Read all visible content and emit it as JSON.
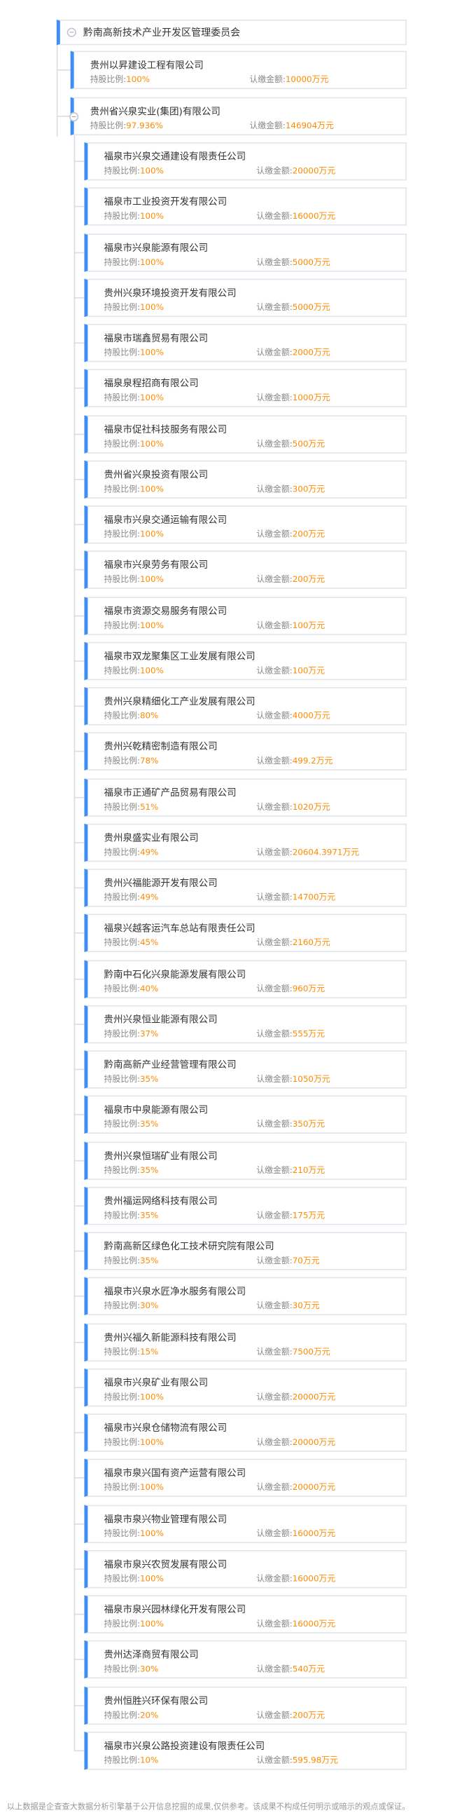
{
  "root": {
    "name": "黔南高新技术产业开发区管理委员会"
  },
  "labels": {
    "share": "持股比例:",
    "capital": "认缴金额:"
  },
  "level1": [
    {
      "name": "贵州以昇建设工程有限公司",
      "share": "100%",
      "capital": "10000万元"
    },
    {
      "name": "贵州省兴泉实业(集团)有限公司",
      "share": "97.936%",
      "capital": "146904万元"
    }
  ],
  "level2": [
    {
      "name": "福泉市兴泉交通建设有限责任公司",
      "share": "100%",
      "capital": "20000万元"
    },
    {
      "name": "福泉市工业投资开发有限公司",
      "share": "100%",
      "capital": "16000万元"
    },
    {
      "name": "福泉市兴泉能源有限公司",
      "share": "100%",
      "capital": "5000万元"
    },
    {
      "name": "贵州兴泉环境投资开发有限公司",
      "share": "100%",
      "capital": "5000万元"
    },
    {
      "name": "福泉市瑞鑫贸易有限公司",
      "share": "100%",
      "capital": "2000万元"
    },
    {
      "name": "福泉泉程招商有限公司",
      "share": "100%",
      "capital": "1000万元"
    },
    {
      "name": "福泉市促社科技服务有限公司",
      "share": "100%",
      "capital": "500万元"
    },
    {
      "name": "贵州省兴泉投资有限公司",
      "share": "100%",
      "capital": "300万元"
    },
    {
      "name": "福泉市兴泉交通运输有限公司",
      "share": "100%",
      "capital": "200万元"
    },
    {
      "name": "福泉市兴泉劳务有限公司",
      "share": "100%",
      "capital": "200万元"
    },
    {
      "name": "福泉市资源交易服务有限公司",
      "share": "100%",
      "capital": "100万元"
    },
    {
      "name": "福泉市双龙聚集区工业发展有限公司",
      "share": "100%",
      "capital": "100万元"
    },
    {
      "name": "贵州兴泉精细化工产业发展有限公司",
      "share": "80%",
      "capital": "4000万元"
    },
    {
      "name": "贵州兴乾精密制造有限公司",
      "share": "78%",
      "capital": "499.2万元"
    },
    {
      "name": "福泉市正通矿产品贸易有限公司",
      "share": "51%",
      "capital": "1020万元"
    },
    {
      "name": "贵州泉盛实业有限公司",
      "share": "49%",
      "capital": "20604.3971万元"
    },
    {
      "name": "贵州兴福能源开发有限公司",
      "share": "49%",
      "capital": "14700万元"
    },
    {
      "name": "福泉兴越客运汽车总站有限责任公司",
      "share": "45%",
      "capital": "2160万元"
    },
    {
      "name": "黔南中石化兴泉能源发展有限公司",
      "share": "40%",
      "capital": "960万元"
    },
    {
      "name": "贵州兴泉恒业能源有限公司",
      "share": "37%",
      "capital": "555万元"
    },
    {
      "name": "黔南高新产业经营管理有限公司",
      "share": "35%",
      "capital": "1050万元"
    },
    {
      "name": "福泉市中泉能源有限公司",
      "share": "35%",
      "capital": "350万元"
    },
    {
      "name": "贵州兴泉恒瑞矿业有限公司",
      "share": "35%",
      "capital": "210万元"
    },
    {
      "name": "贵州福运网络科技有限公司",
      "share": "35%",
      "capital": "175万元"
    },
    {
      "name": "黔南高新区绿色化工技术研究院有限公司",
      "share": "35%",
      "capital": "70万元"
    },
    {
      "name": "福泉市兴泉水匠净水服务有限公司",
      "share": "30%",
      "capital": "30万元"
    },
    {
      "name": "贵州兴福久新能源科技有限公司",
      "share": "15%",
      "capital": "7500万元"
    },
    {
      "name": "福泉市兴泉矿业有限公司",
      "share": "100%",
      "capital": "20000万元"
    },
    {
      "name": "福泉市兴泉仓储物流有限公司",
      "share": "100%",
      "capital": "20000万元"
    },
    {
      "name": "福泉市泉兴国有资产运营有限公司",
      "share": "100%",
      "capital": "20000万元"
    },
    {
      "name": "福泉市泉兴物业管理有限公司",
      "share": "100%",
      "capital": "16000万元"
    },
    {
      "name": "福泉市泉兴农贸发展有限公司",
      "share": "100%",
      "capital": "16000万元"
    },
    {
      "name": "福泉市泉兴园林绿化开发有限公司",
      "share": "100%",
      "capital": "16000万元"
    },
    {
      "name": "贵州达泽商贸有限公司",
      "share": "30%",
      "capital": "540万元"
    },
    {
      "name": "贵州恒胜兴环保有限公司",
      "share": "20%",
      "capital": "200万元"
    },
    {
      "name": "福泉市兴泉公路投资建设有限责任公司",
      "share": "10%",
      "capital": "595.98万元"
    }
  ],
  "footer": "以上数据是企查查大数据分析引擎基于公开信息挖掘的成果,仅供参考。该成果不构成任何明示或暗示的观点或保证。",
  "colors": {
    "accent": "#3e8ef7",
    "value": "#ff8a00",
    "label": "#888888",
    "border": "#e2e6ec"
  }
}
